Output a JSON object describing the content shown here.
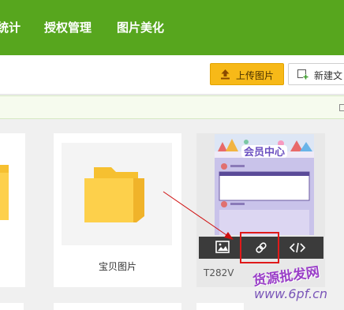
{
  "nav": {
    "items": [
      {
        "label": "统计"
      },
      {
        "label": "授权管理"
      },
      {
        "label": "图片美化"
      }
    ]
  },
  "toolbar": {
    "upload_label": "上传图片",
    "new_file_label": "新建文"
  },
  "folder": {
    "label": "宝贝图片"
  },
  "image_card": {
    "name": "T282V",
    "poster_title": "会员中心"
  },
  "watermark": {
    "line1": "货源批发网",
    "line2": "www.6pf.cn"
  },
  "colors": {
    "nav_green": "#57a61e",
    "upload_yellow": "#f7b918",
    "highlight_red": "#e01a1a",
    "folder_yellow": "#fdd04b"
  }
}
